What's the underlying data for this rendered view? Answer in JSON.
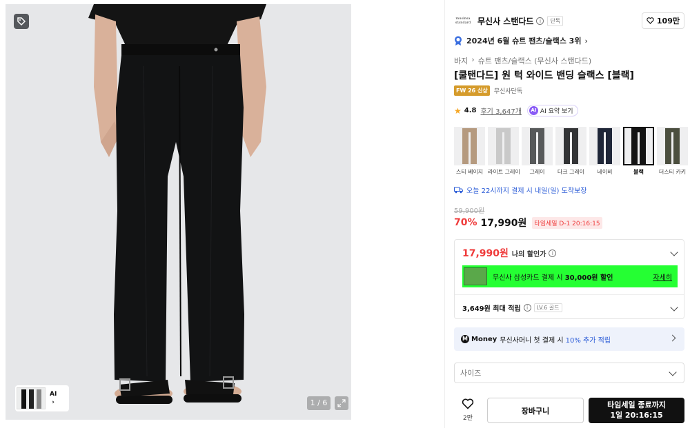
{
  "gallery": {
    "counter": "1 / 6",
    "thumb_ai_label": "AI",
    "icons": [
      "coupon-tag-icon",
      "expand-icon",
      "chevron-right-icon"
    ]
  },
  "brand": {
    "logo_text": "musinsa standard",
    "name": "무신사 스탠다드",
    "exclusive": "단독",
    "likes": "109만"
  },
  "ranking": {
    "text": "2024년 6월 슈트 팬츠/슬랙스 3위"
  },
  "breadcrumb": [
    "바지",
    "슈트 팬츠/슬랙스 (무신사 스탠다드)"
  ],
  "product": {
    "title": "[쿨탠다드] 원 턱 와이드 밴딩 슬랙스 [블랙]",
    "tag_new": "FW 26 신상",
    "tag_exclusive": "무신사단독",
    "rating": "4.8",
    "reviews": "후기 3,647개",
    "ai_summary": "AI 요약 보기",
    "ai_badge": "AI"
  },
  "colors": [
    {
      "label": "스티 베이지",
      "color": "#b59a7f",
      "selected": false
    },
    {
      "label": "라이트 그레이",
      "color": "#c9c9c9",
      "selected": false
    },
    {
      "label": "그레이",
      "color": "#57595a",
      "selected": false
    },
    {
      "label": "다크 그레이",
      "color": "#333436",
      "selected": false
    },
    {
      "label": "네이비",
      "color": "#1f2638",
      "selected": false
    },
    {
      "label": "블랙",
      "color": "#141414",
      "selected": true
    },
    {
      "label": "더스티 카키",
      "color": "#4b4e3e",
      "selected": false
    }
  ],
  "delivery": {
    "text": "오늘 22시까지 결제 시 내일(일) 도착보장"
  },
  "price": {
    "original": "59,900원",
    "discount": "70%",
    "sale": "17,990원",
    "timer": "타임세일 D-1 20:16:15"
  },
  "benefits": {
    "my_price": "17,990원",
    "my_price_label": "나의 할인가",
    "card_text_prefix": "무신사 삼성카드 결제 시 ",
    "card_text_bold": "30,000원 할인",
    "card_more": "자세히",
    "points": "3,649원 최대 적립",
    "level": "LV.6 골드"
  },
  "money": {
    "icon": "M",
    "brand": "Money",
    "text": "무신사머니 첫 결제 시",
    "highlight": "10% 추가 적립"
  },
  "size": {
    "placeholder": "사이즈"
  },
  "actions": {
    "wish_count": "2만",
    "cart": "장바구니",
    "buy_line1": "타임세일 종료까지",
    "buy_line2": "1일 20:16:15"
  },
  "accent_colors": {
    "sale_red": "#ef3b3b",
    "link_blue": "#2a5bd7",
    "card_green": "#25ff33"
  }
}
